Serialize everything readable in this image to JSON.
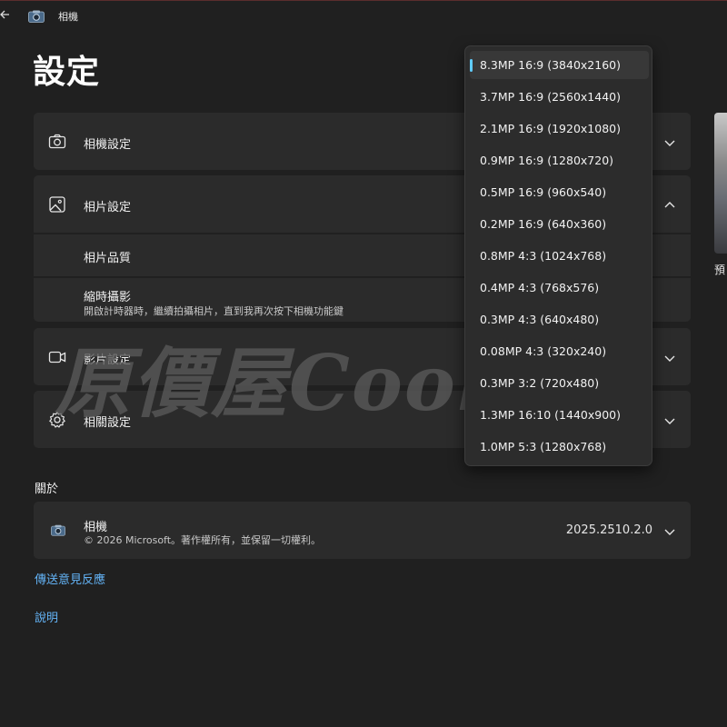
{
  "app": {
    "title": "相機"
  },
  "page": {
    "title": "設定"
  },
  "sections": {
    "camera_settings": {
      "label": "相機設定"
    },
    "photo_settings": {
      "label": "相片設定",
      "quality_label": "相片品質",
      "timelapse_label": "縮時攝影",
      "timelapse_desc": "開啟計時器時，繼續拍攝相片，直到我再次按下相機功能鍵"
    },
    "video_settings": {
      "label": "影片設定"
    },
    "related_settings": {
      "label": "相關設定"
    }
  },
  "about": {
    "heading": "關於",
    "app_name": "相機",
    "copyright": "© 2026 Microsoft。著作權所有，並保留一切權利。",
    "version": "2025.2510.2.0"
  },
  "links": {
    "feedback": "傳送意見反應",
    "help": "說明"
  },
  "preview": {
    "label": "預"
  },
  "dropdown": {
    "selected_index": 0,
    "options": [
      "8.3MP 16:9 (3840x2160)",
      "3.7MP 16:9 (2560x1440)",
      "2.1MP 16:9 (1920x1080)",
      "0.9MP 16:9 (1280x720)",
      "0.5MP 16:9 (960x540)",
      "0.2MP 16:9 (640x360)",
      "0.8MP 4:3 (1024x768)",
      "0.4MP 4:3 (768x576)",
      "0.3MP 4:3 (640x480)",
      "0.08MP 4:3 (320x240)",
      "0.3MP 3:2 (720x480)",
      "1.3MP 16:10 (1440x900)",
      "1.0MP 5:3 (1280x768)"
    ]
  },
  "watermark": {
    "text": "原價屋Coolpc"
  },
  "colors": {
    "accent": "#60cdff",
    "link": "#63b3f6",
    "background": "#202020",
    "card": "#2b2b2b"
  }
}
